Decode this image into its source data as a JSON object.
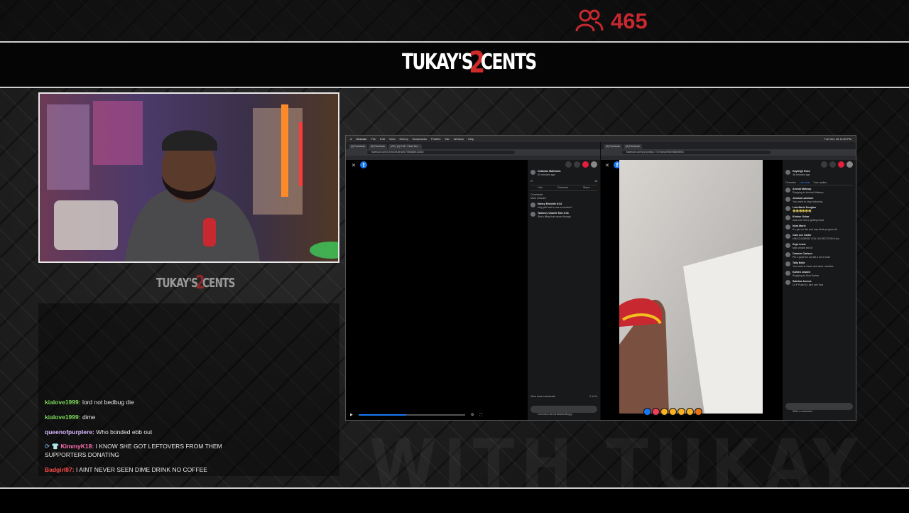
{
  "overlay": {
    "viewer_count": "465",
    "viewer_icon": "people-icon",
    "brand_logo": "TUKAY'S 2 CENTS",
    "accent_color": "#c8282f"
  },
  "chat": {
    "messages": [
      {
        "user": "kialove1999:",
        "user_color": "#7ddb5a",
        "text": "lord not bedbug die"
      },
      {
        "user": "kialove1999:",
        "user_color": "#7ddb5a",
        "text": "dime"
      },
      {
        "user": "queenofpurplere:",
        "user_color": "#d7b8ff",
        "text": "Who bonded ebb out"
      },
      {
        "user": "KimmyK18:",
        "user_color": "#ff6fb2",
        "text": "I KNOW SHE GOT LEFTOVERS FROM THEM SUPPORTERS DONATING",
        "badges": "⟳ 👕"
      },
      {
        "user": "Badgirl87:",
        "user_color": "#ff4b4b",
        "text": "I AINT NEVER SEEN DIME DRINK NO COFFEE"
      }
    ]
  },
  "shared_screen": {
    "menu_items": [
      "Chrome",
      "File",
      "Edit",
      "View",
      "History",
      "Bookmarks",
      "Profiles",
      "Tab",
      "Window",
      "Help"
    ],
    "clock": "Tue Dec 16 11:50 PM",
    "left_browser": {
      "tabs": [
        "(6) Facebook",
        "(5) Facebook",
        "(23+) (2) 9:45 - Flash Dei..."
      ],
      "url": "facebook.com/LiOnsOnUteus/b/768668801638/3",
      "post_author": "Octavius Matthews",
      "post_meta": "43 minutes ago",
      "reaction_count": "27",
      "comment_count": "18",
      "like_label": "Like",
      "comment_label": "Comment",
      "share_label": "Share",
      "comments_header": "Comments",
      "most_relevant": "Most relevant",
      "comments": [
        {
          "name": "Nancy Michelle",
          "time": "8:34",
          "text": "why yall had to use a condom?"
        },
        {
          "name": "Tammey Charlie Tate",
          "time": "8:31",
          "text": "She's filing that report though"
        }
      ],
      "view_more": "View more comments",
      "comment_count_text": "2 of 14",
      "comment_placeholder": "Comment as Da Atlanta Boyyy"
    },
    "right_browser": {
      "tabs": [
        "(6) Facebook",
        "(6) Facebook"
      ],
      "url": "facebook.com/yo/t.phillips.7?2/videos/9567686808f33",
      "live_badge": "LIVE",
      "viewers": "2.3K",
      "streamer": "Kayleigh Rose",
      "stream_meta": "48 minutes ago",
      "tabs_row": [
        "Overview",
        "Live chat",
        "Your replies"
      ],
      "comments": [
        {
          "name": "Anchal Makeup",
          "text": "Replying to Anchal Makeup"
        },
        {
          "name": "Jessica Landrum",
          "text": "You need to stop following"
        },
        {
          "name": "Lola Marie Douglas",
          "text": "😂😂😂😂😂😂"
        },
        {
          "name": "Kirsten Ozkar",
          "text": "was over there getting head"
        },
        {
          "name": "Nora Marie",
          "text": "if u get on live and say what ya gone do"
        },
        {
          "name": "Cain Lee Carter",
          "text": "HIM CLEARED YOU ON SECTION 8 too"
        },
        {
          "name": "Deja Lewis",
          "text": "Man what's this lil"
        },
        {
          "name": "Carmen Carlson",
          "text": "Pill u gone be out wit a lot of cats"
        },
        {
          "name": "Tally Belle",
          "text": "Your skin is clean and clear marblee"
        },
        {
          "name": "Kahlen Jeanne",
          "text": "Replying to Kiwi Dorian"
        },
        {
          "name": "Sabrina Jennes",
          "text": "Dr P Push B I ain't see that"
        }
      ],
      "comment_placeholder": "Write a comment..."
    }
  },
  "watermark_text": "WITH TUKAY"
}
